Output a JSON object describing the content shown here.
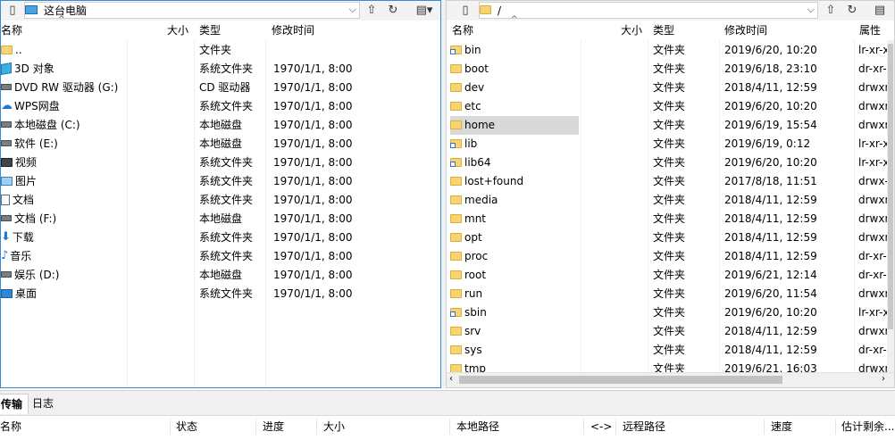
{
  "left": {
    "path": "这台电脑",
    "columns": {
      "name": "名称",
      "size": "大小",
      "type": "类型",
      "modified": "修改时间"
    },
    "rows": [
      {
        "icon": "folder-up-icon",
        "name": "..",
        "size": "",
        "type": "文件夹",
        "modified": ""
      },
      {
        "icon": "3d-objects-icon",
        "name": "3D 对象",
        "size": "",
        "type": "系统文件夹",
        "modified": "1970/1/1, 8:00"
      },
      {
        "icon": "dvd-drive-icon",
        "name": "DVD RW 驱动器 (G:)",
        "size": "",
        "type": "CD 驱动器",
        "modified": "1970/1/1, 8:00"
      },
      {
        "icon": "cloud-icon",
        "name": "WPS网盘",
        "size": "",
        "type": "系统文件夹",
        "modified": "1970/1/1, 8:00"
      },
      {
        "icon": "drive-icon",
        "name": "本地磁盘 (C:)",
        "size": "",
        "type": "本地磁盘",
        "modified": "1970/1/1, 8:00"
      },
      {
        "icon": "drive-icon",
        "name": "软件 (E:)",
        "size": "",
        "type": "本地磁盘",
        "modified": "1970/1/1, 8:00"
      },
      {
        "icon": "video-icon",
        "name": "视频",
        "size": "",
        "type": "系统文件夹",
        "modified": "1970/1/1, 8:00"
      },
      {
        "icon": "picture-icon",
        "name": "图片",
        "size": "",
        "type": "系统文件夹",
        "modified": "1970/1/1, 8:00"
      },
      {
        "icon": "document-icon",
        "name": "文档",
        "size": "",
        "type": "系统文件夹",
        "modified": "1970/1/1, 8:00"
      },
      {
        "icon": "drive-icon",
        "name": "文档 (F:)",
        "size": "",
        "type": "本地磁盘",
        "modified": "1970/1/1, 8:00"
      },
      {
        "icon": "download-icon",
        "name": "下载",
        "size": "",
        "type": "系统文件夹",
        "modified": "1970/1/1, 8:00"
      },
      {
        "icon": "music-icon",
        "name": "音乐",
        "size": "",
        "type": "系统文件夹",
        "modified": "1970/1/1, 8:00"
      },
      {
        "icon": "drive-icon",
        "name": "娱乐 (D:)",
        "size": "",
        "type": "本地磁盘",
        "modified": "1970/1/1, 8:00"
      },
      {
        "icon": "desktop-icon",
        "name": "桌面",
        "size": "",
        "type": "系统文件夹",
        "modified": "1970/1/1, 8:00"
      }
    ]
  },
  "right": {
    "path": "/",
    "columns": {
      "name": "名称",
      "size": "大小",
      "type": "类型",
      "modified": "修改时间",
      "attr": "属性"
    },
    "rows": [
      {
        "icon": "folder-link-icon",
        "name": "bin",
        "type": "文件夹",
        "modified": "2019/6/20, 10:20",
        "attr": "lr-xr-x"
      },
      {
        "icon": "folder-icon",
        "name": "boot",
        "type": "文件夹",
        "modified": "2019/6/18, 23:10",
        "attr": "dr-xr-x"
      },
      {
        "icon": "folder-icon",
        "name": "dev",
        "type": "文件夹",
        "modified": "2018/4/11, 12:59",
        "attr": "drwxr-x"
      },
      {
        "icon": "folder-icon",
        "name": "etc",
        "type": "文件夹",
        "modified": "2019/6/20, 10:20",
        "attr": "drwxr-x"
      },
      {
        "icon": "folder-icon",
        "name": "home",
        "type": "文件夹",
        "modified": "2019/6/19, 15:54",
        "attr": "drwxr-x",
        "selected": true
      },
      {
        "icon": "folder-link-icon",
        "name": "lib",
        "type": "文件夹",
        "modified": "2019/6/19, 0:12",
        "attr": "lr-xr-x"
      },
      {
        "icon": "folder-link-icon",
        "name": "lib64",
        "type": "文件夹",
        "modified": "2019/6/20, 10:20",
        "attr": "lr-xr-x"
      },
      {
        "icon": "folder-icon",
        "name": "lost+found",
        "type": "文件夹",
        "modified": "2017/8/18, 11:51",
        "attr": "drwx--"
      },
      {
        "icon": "folder-icon",
        "name": "media",
        "type": "文件夹",
        "modified": "2018/4/11, 12:59",
        "attr": "drwxr-x"
      },
      {
        "icon": "folder-icon",
        "name": "mnt",
        "type": "文件夹",
        "modified": "2018/4/11, 12:59",
        "attr": "drwxr-x"
      },
      {
        "icon": "folder-icon",
        "name": "opt",
        "type": "文件夹",
        "modified": "2018/4/11, 12:59",
        "attr": "drwxr-x"
      },
      {
        "icon": "folder-icon",
        "name": "proc",
        "type": "文件夹",
        "modified": "2018/4/11, 12:59",
        "attr": "dr-xr-x"
      },
      {
        "icon": "folder-icon",
        "name": "root",
        "type": "文件夹",
        "modified": "2019/6/21, 12:14",
        "attr": "dr-xr-x"
      },
      {
        "icon": "folder-icon",
        "name": "run",
        "type": "文件夹",
        "modified": "2019/6/20, 11:54",
        "attr": "drwxr-x"
      },
      {
        "icon": "folder-link-icon",
        "name": "sbin",
        "type": "文件夹",
        "modified": "2019/6/20, 10:20",
        "attr": "lr-xr-x"
      },
      {
        "icon": "folder-icon",
        "name": "srv",
        "type": "文件夹",
        "modified": "2018/4/11, 12:59",
        "attr": "drwxr-x"
      },
      {
        "icon": "folder-icon",
        "name": "sys",
        "type": "文件夹",
        "modified": "2018/4/11, 12:59",
        "attr": "dr-xr-x"
      },
      {
        "icon": "folder-icon",
        "name": "tmp",
        "type": "文件夹",
        "modified": "2019/6/21, 16:03",
        "attr": "drwxrwx"
      }
    ]
  },
  "tabs": [
    {
      "label": "传输",
      "active": true
    },
    {
      "label": "日志",
      "active": false
    }
  ],
  "transfer_columns": [
    "名称",
    "状态",
    "进度",
    "大小",
    "本地路径",
    "<->",
    "远程路径",
    "速度",
    "估计剩余..."
  ]
}
